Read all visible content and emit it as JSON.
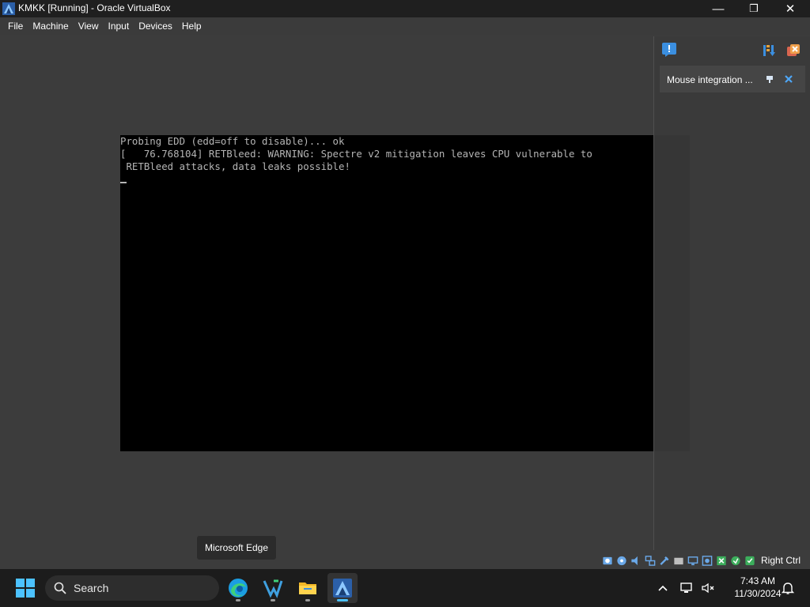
{
  "window": {
    "title": "KMKK [Running] - Oracle VirtualBox",
    "minimize_glyph": "—",
    "restore_glyph": "❐",
    "close_glyph": "✕"
  },
  "menu": {
    "items": [
      "File",
      "Machine",
      "View",
      "Input",
      "Devices",
      "Help"
    ]
  },
  "console": {
    "lines": [
      "Probing EDD (edd=off to disable)... ok",
      "[   76.768104] RETBleed: WARNING: Spectre v2 mitigation leaves CPU vulnerable to",
      " RETBleed attacks, data leaks possible!"
    ]
  },
  "notification_center": {
    "message": "Mouse integration ..."
  },
  "status_bar": {
    "host_key": "Right Ctrl"
  },
  "tooltip": {
    "text": "Microsoft Edge"
  },
  "taskbar": {
    "search_label": "Search",
    "time": "7:43 AM",
    "date": "11/30/2024"
  },
  "colors": {
    "accent": "#4cc2ff",
    "console_text": "#b5b5b5",
    "vm_background": "#000000"
  }
}
